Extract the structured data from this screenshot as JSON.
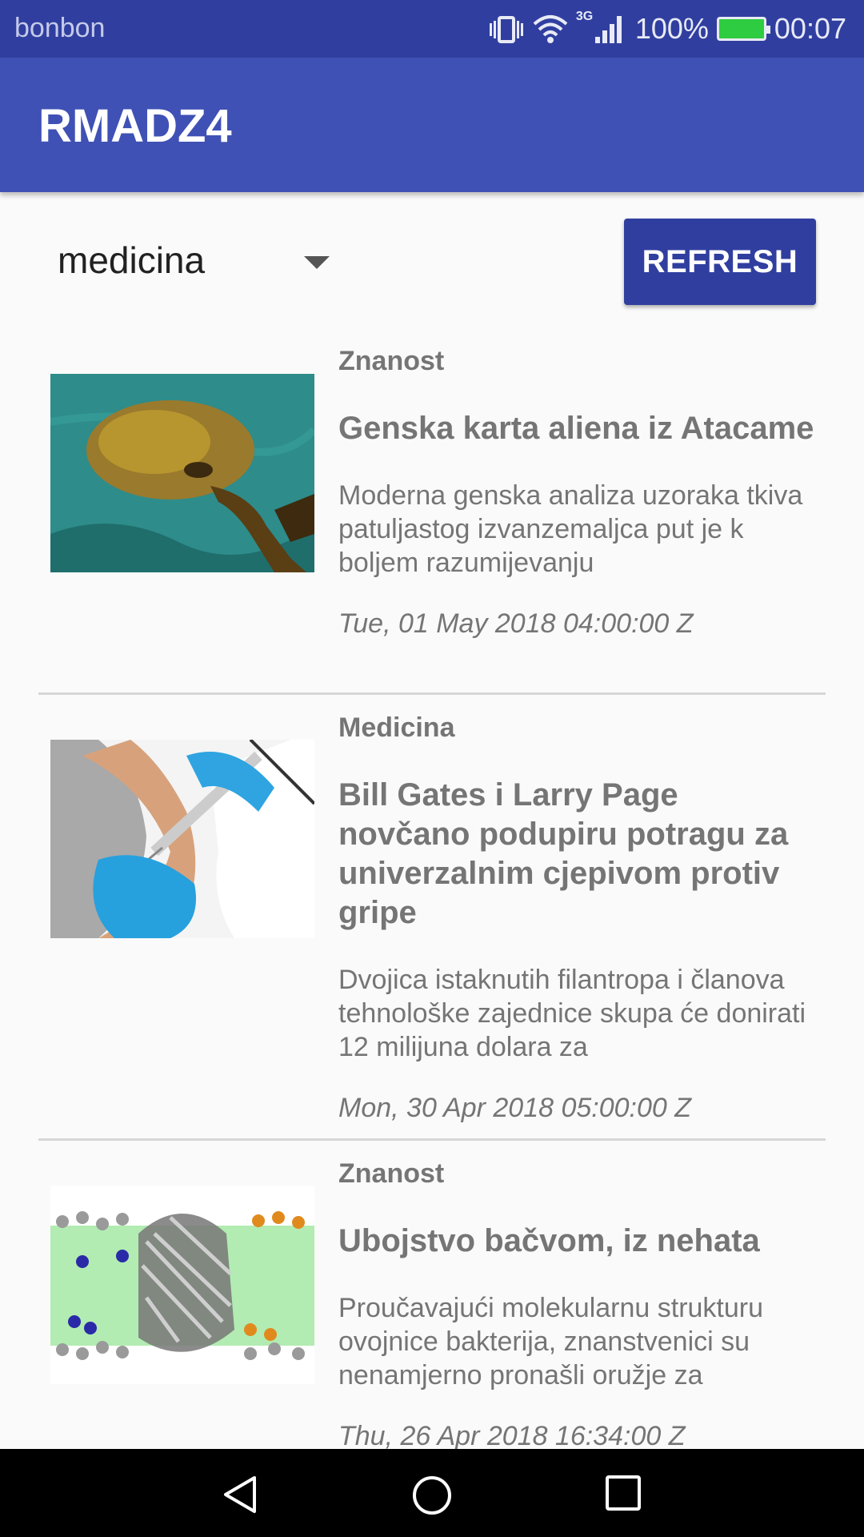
{
  "status_bar": {
    "carrier": "bonbon",
    "network_tag": "3G",
    "battery_percent": "100%",
    "time": "00:07",
    "battery_color": "#2ecc40"
  },
  "app_bar": {
    "title": "RMADZ4",
    "color": "#3f51b5"
  },
  "controls": {
    "spinner_value": "medicina",
    "refresh_label": "REFRESH"
  },
  "articles": [
    {
      "category": "Znanost",
      "title": "Genska karta aliena iz Atacame",
      "description": "Moderna genska analiza uzoraka tkiva patuljastog izvanzemaljca put je k boljem razumijevanju",
      "date": "Tue, 01 May 2018 04:00:00 Z",
      "image_icon": "alien-skeleton-image"
    },
    {
      "category": "Medicina",
      "title": "Bill Gates i Larry Page novčano podupiru potragu za univerzalnim cjepivom protiv gripe",
      "description": "Dvojica istaknutih filantropa i članova tehnološke zajednice skupa će donirati 12 milijuna dolara za",
      "date": "Mon, 30 Apr 2018 05:00:00 Z",
      "image_icon": "vaccination-image"
    },
    {
      "category": "Znanost",
      "title": "Ubojstvo bačvom, iz nehata",
      "description": "Proučavajući molekularnu strukturu ovojnice bakterija, znanstvenici su nenamjerno pronašli oružje za",
      "date": "Thu, 26 Apr 2018 16:34:00 Z",
      "image_icon": "protein-barrel-image"
    }
  ]
}
